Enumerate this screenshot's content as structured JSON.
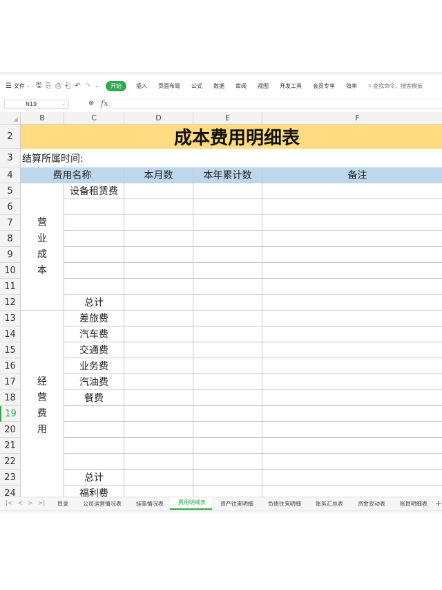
{
  "toolbar": {
    "file_label": "文件",
    "tabs": [
      "开始",
      "插入",
      "页面布局",
      "公式",
      "数据",
      "审阅",
      "视图",
      "开发工具",
      "会员专享",
      "效率"
    ],
    "active_tab": "开始",
    "search_placeholder": "查找命令、搜索模板",
    "accent_color": "#2fa84f"
  },
  "formula_bar": {
    "cell_ref": "N19",
    "fx_label": "fx",
    "value": ""
  },
  "columns": [
    "B",
    "C",
    "D",
    "E",
    "F"
  ],
  "rows": [
    "2",
    "3",
    "4",
    "5",
    "6",
    "7",
    "8",
    "9",
    "10",
    "11",
    "12",
    "13",
    "14",
    "15",
    "16",
    "17",
    "18",
    "19",
    "20",
    "21",
    "22",
    "23",
    "24"
  ],
  "selected_row": "19",
  "sheet": {
    "title": "成本费用明细表",
    "period_label": "结算所属时间:",
    "headers": {
      "name": "费用名称",
      "month": "本月数",
      "ytd": "本年累计数",
      "note": "备注"
    },
    "groups": [
      {
        "label": "营业成本",
        "chars": [
          "营",
          "业",
          "成",
          "本"
        ]
      },
      {
        "label": "经营费用",
        "chars": [
          "经",
          "营",
          "费",
          "用"
        ]
      }
    ],
    "items": {
      "r5": "设备租赁费",
      "r12": "总计",
      "r13": "差旅费",
      "r14": "汽车费",
      "r15": "交通费",
      "r16": "业务费",
      "r17": "汽油费",
      "r18": "餐费",
      "r23": "总计",
      "r24": "福利费"
    },
    "title_bg": "#ffdc82",
    "header_bg": "#bdd7ee"
  },
  "sheet_tabs": [
    "目录",
    "公司运营情况表",
    "挂靠情况表",
    "费用明细表",
    "资产往来明细",
    "负债往来明细",
    "账务汇总表",
    "资金变动表",
    "账目明细表"
  ],
  "active_sheet": "费用明细表"
}
